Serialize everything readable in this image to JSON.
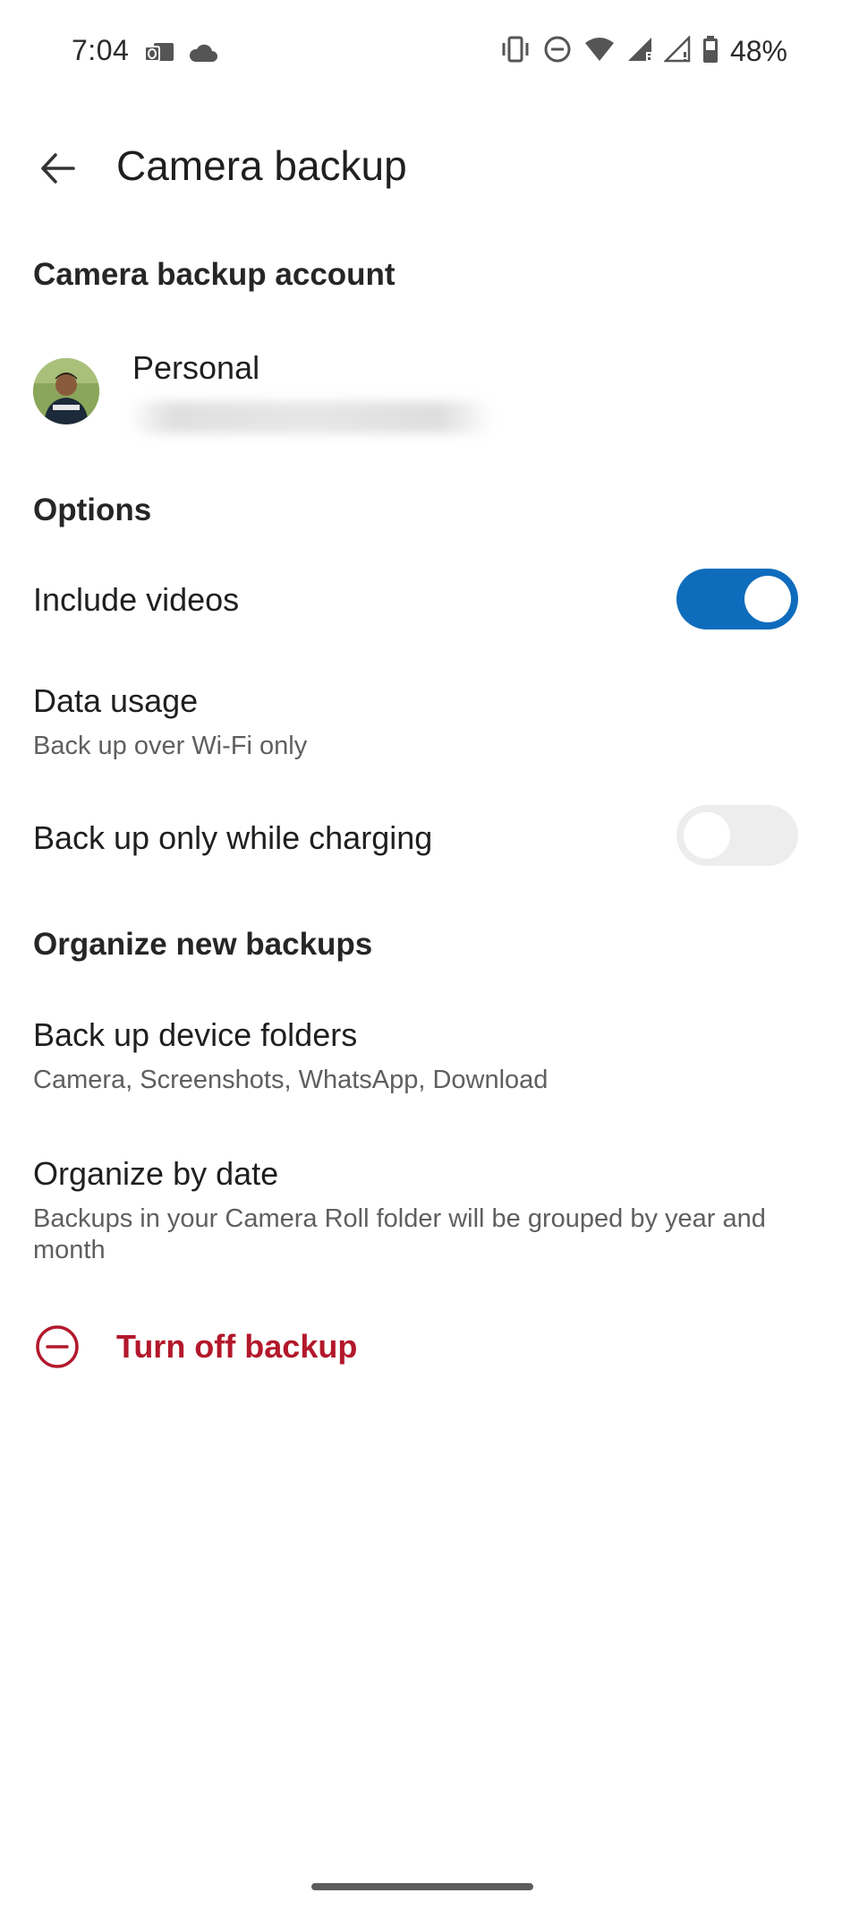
{
  "status_bar": {
    "time": "7:04",
    "battery_percent": "48%",
    "icons": [
      "outlook-notification-icon",
      "cloud-icon",
      "vibrate-icon",
      "do-not-disturb-icon",
      "wifi-icon",
      "signal-icon",
      "signal-no-data-icon",
      "battery-icon"
    ]
  },
  "app_bar": {
    "title": "Camera backup",
    "back_icon": "arrow-left-icon"
  },
  "account_section": {
    "header": "Camera backup account",
    "account_name": "Personal"
  },
  "options_section": {
    "header": "Options",
    "include_videos": {
      "label": "Include videos",
      "enabled": true
    },
    "data_usage": {
      "label": "Data usage",
      "value": "Back up over Wi-Fi only"
    },
    "charging_only": {
      "label": "Back up only while charging",
      "enabled": false
    }
  },
  "organize_section": {
    "header": "Organize new backups",
    "device_folders": {
      "label": "Back up device folders",
      "value": "Camera, Screenshots, WhatsApp, Download"
    },
    "organize_by_date": {
      "label": "Organize by date",
      "value": "Backups in your Camera Roll folder will be grouped by year and month"
    }
  },
  "turn_off": {
    "label": "Turn off backup",
    "icon": "minus-circle-icon"
  },
  "colors": {
    "accent": "#0f6cbd",
    "danger": "#b3182b",
    "toggle_off": "#ededed",
    "text_primary": "#1f1f1f",
    "text_secondary": "#5f5f5f"
  }
}
